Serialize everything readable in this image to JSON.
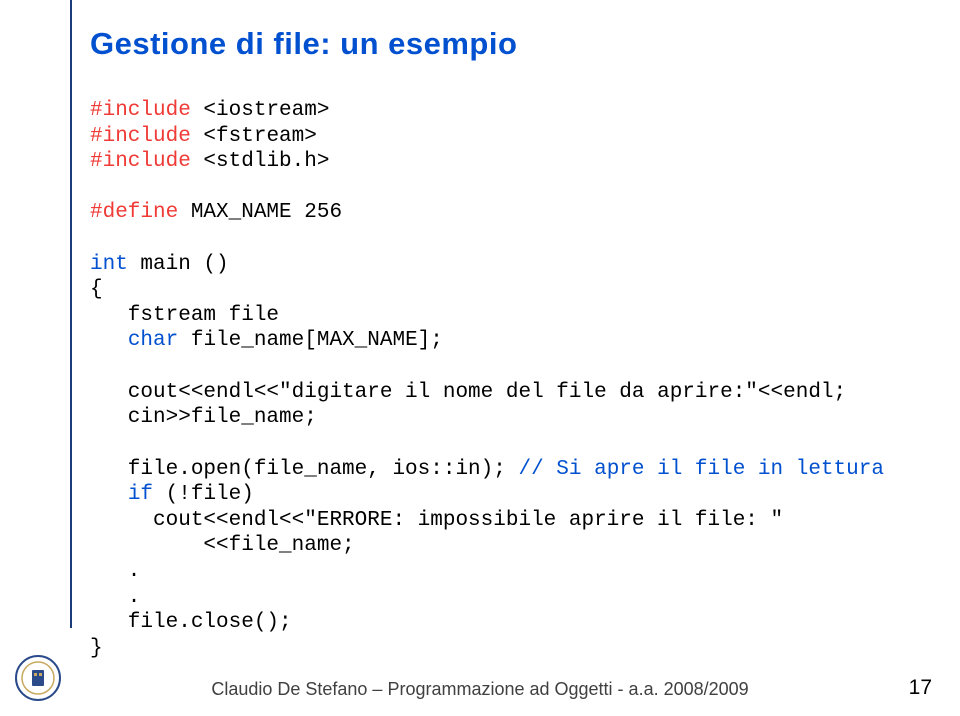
{
  "title": "Gestione di file: un esempio",
  "code": {
    "l1a": "#include",
    "l1b": " <iostream>",
    "l2a": "#include",
    "l2b": " <fstream>",
    "l3a": "#include",
    "l3b": " <stdlib.h>",
    "l4a": "#define",
    "l4b": " MAX_NAME 256",
    "l5a": "int",
    "l5b": " main ()",
    "l6": "{",
    "l7a": "   fstream file",
    "l8a": "   ",
    "l8b": "char",
    "l8c": " file_name[MAX_NAME];",
    "l9": "   cout<<endl<<\"digitare il nome del file da aprire:\"<<endl;",
    "l10": "   cin>>file_name;",
    "l11a": "   file.open(file_name, ios::in); ",
    "l11b": "// Si apre il file in lettura",
    "l12a": "   ",
    "l12b": "if",
    "l12c": " (!file)",
    "l13": "     cout<<endl<<\"ERRORE: impossibile aprire il file: \"",
    "l14": "         <<file_name;",
    "l15": "   .",
    "l16": "   .",
    "l17": "   file.close();",
    "l18": "}"
  },
  "footer": "Claudio De Stefano – Programmazione ad Oggetti - a.a. 2008/2009",
  "page": "17"
}
